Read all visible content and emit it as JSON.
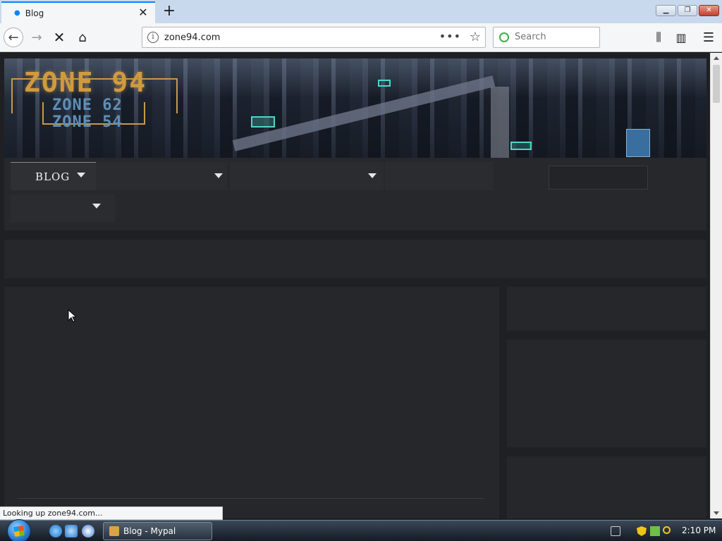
{
  "browser": {
    "tab": {
      "title": "Blog"
    },
    "url": "zone94.com",
    "search_placeholder": "Search",
    "status_text": "Looking up zone94.com..."
  },
  "site": {
    "logo": {
      "main": "ZONE 94",
      "sub1": "ZONE 62",
      "sub2": "ZONE 54"
    },
    "nav": {
      "blog_label": "BLOG"
    }
  },
  "taskbar": {
    "task_label": "Blog - Mypal",
    "clock": "2:10 PM"
  },
  "colors": {
    "page_bg": "#1f2023",
    "panel_bg": "#26272a",
    "logo_orange": "#d09a3e",
    "logo_blue": "#5d8fb8",
    "tab_accent": "#0a84ff"
  }
}
